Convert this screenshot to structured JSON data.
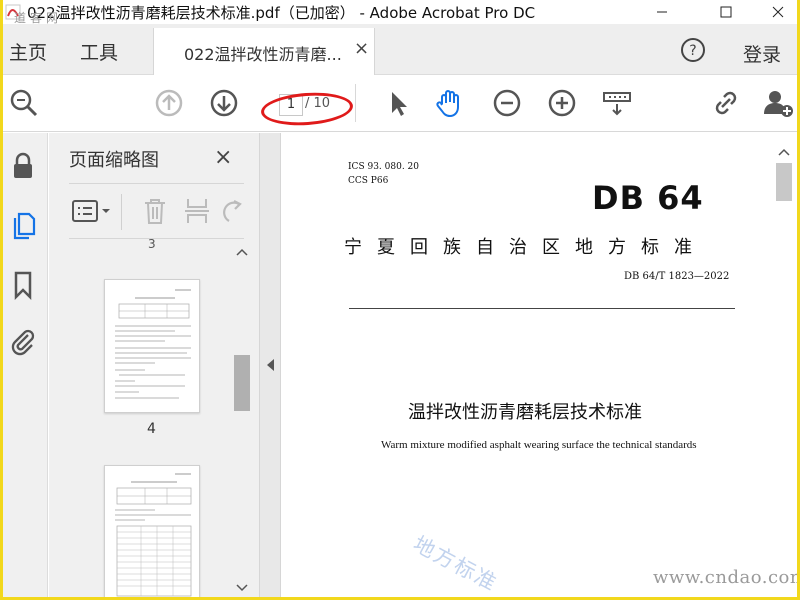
{
  "window": {
    "title": "022温拌改性沥青磨耗层技术标准.pdf（已加密） - Adobe Acrobat Pro DC"
  },
  "nav": {
    "home": "主页",
    "tools": "工具",
    "doc_tab": "022温拌改性沥青磨...",
    "login": "登录"
  },
  "toolbar": {
    "page_current": "1",
    "page_total": "/ 10"
  },
  "thumbnails": {
    "title": "页面缩略图",
    "page_label_top": "3",
    "page_label_4": "4"
  },
  "document": {
    "ics": "ICS  93. 080. 20",
    "ccs": "CCS  P66",
    "db_mark": "DB 64",
    "authority": "宁夏回族自治区地方标准",
    "code": "DB 64/T  1823—2022",
    "title": "温拌改性沥青磨耗层技术标准",
    "subtitle": "Warm mixture modified asphalt wearing surface the technical standards"
  },
  "watermarks": {
    "top_left": "道客网",
    "diagonal": "地方标准",
    "url": "www.cndao.com"
  },
  "colors": {
    "frame": "#f2d81c",
    "hand_tool_active": "#1473e6",
    "annotation_circle": "#e01a1a"
  }
}
